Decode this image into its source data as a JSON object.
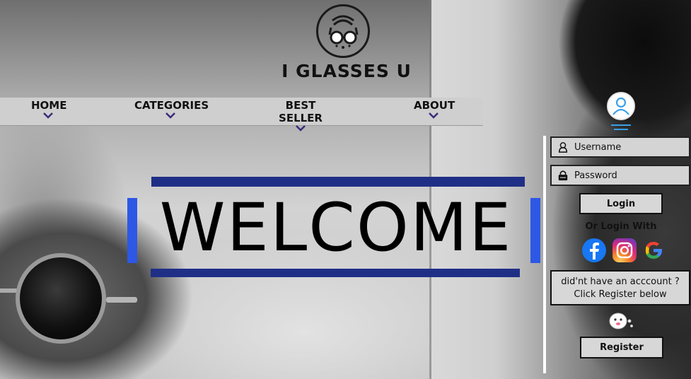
{
  "brand": {
    "title": "I GLASSES U",
    "logo_icon": "glasses-logo-icon"
  },
  "nav": {
    "items": [
      {
        "label": "HOME"
      },
      {
        "label": "CATEGORIES"
      },
      {
        "label": "BEST SELLER"
      },
      {
        "label": "ABOUT"
      }
    ],
    "dropdown_icon": "chevron-down-icon"
  },
  "hero": {
    "text": "WELCOME"
  },
  "login": {
    "username_placeholder": "Username",
    "password_placeholder": "Password",
    "login_label": "Login",
    "or_login_with": "Or Login With",
    "social": [
      "facebook-icon",
      "instagram-icon",
      "google-icon"
    ],
    "no_account_line1": "did'nt have an acccount ?",
    "no_account_line2": "Click Register below",
    "register_label": "Register"
  },
  "colors": {
    "accent_dark_blue": "#1f2f86",
    "accent_blue": "#2d58e6",
    "panel_bg": "#d7d7d7",
    "nav_bg": "#cfcfcf"
  }
}
